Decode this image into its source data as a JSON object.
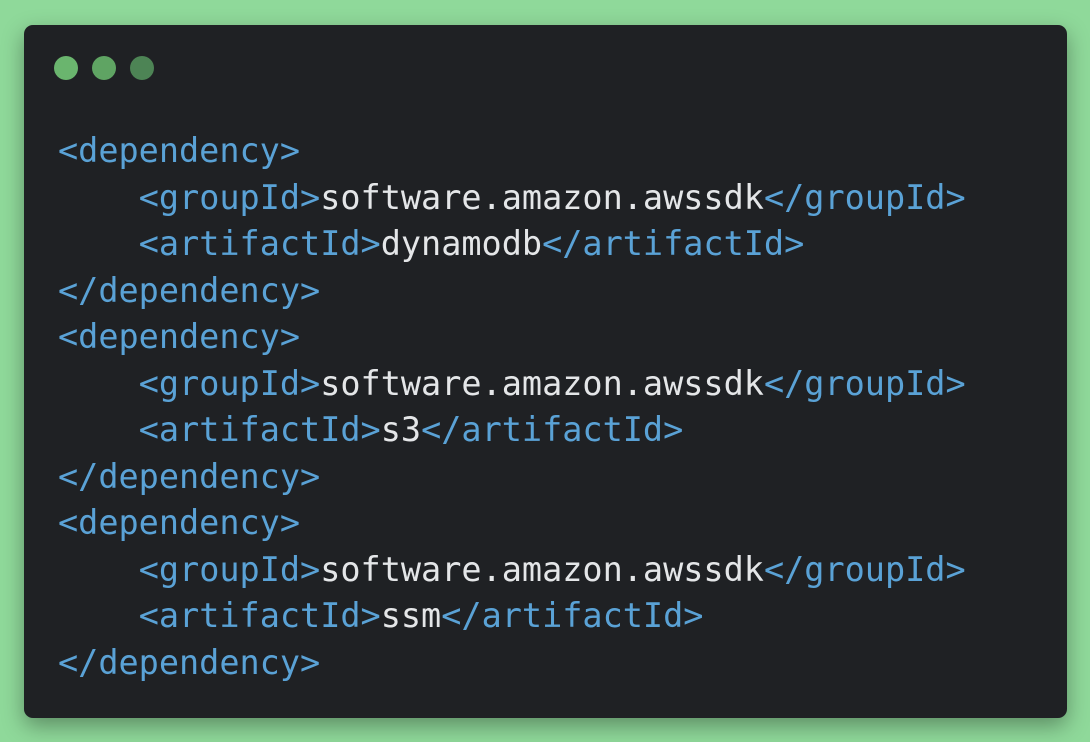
{
  "theme": {
    "background": "#8fd99a",
    "window_bg": "#1f2124",
    "tag_color": "#5aa2d6",
    "text_color": "#e4e6e8"
  },
  "window_controls": [
    {
      "name": "window-dot-1",
      "color": "#6ab56e"
    },
    {
      "name": "window-dot-2",
      "color": "#5fa463"
    },
    {
      "name": "window-dot-3",
      "color": "#4d8455"
    }
  ],
  "code_lines": [
    {
      "indent": "",
      "parts": [
        {
          "t": "tag",
          "v": "<dependency>"
        }
      ]
    },
    {
      "indent": "    ",
      "parts": [
        {
          "t": "tag",
          "v": "<groupId>"
        },
        {
          "t": "text",
          "v": "software.amazon.awssdk"
        },
        {
          "t": "tag",
          "v": "</groupId>"
        }
      ]
    },
    {
      "indent": "    ",
      "parts": [
        {
          "t": "tag",
          "v": "<artifactId>"
        },
        {
          "t": "text",
          "v": "dynamodb"
        },
        {
          "t": "tag",
          "v": "</artifactId>"
        }
      ]
    },
    {
      "indent": "",
      "parts": [
        {
          "t": "tag",
          "v": "</dependency>"
        }
      ]
    },
    {
      "indent": "",
      "parts": [
        {
          "t": "tag",
          "v": "<dependency>"
        }
      ]
    },
    {
      "indent": "    ",
      "parts": [
        {
          "t": "tag",
          "v": "<groupId>"
        },
        {
          "t": "text",
          "v": "software.amazon.awssdk"
        },
        {
          "t": "tag",
          "v": "</groupId>"
        }
      ]
    },
    {
      "indent": "    ",
      "parts": [
        {
          "t": "tag",
          "v": "<artifactId>"
        },
        {
          "t": "text",
          "v": "s3"
        },
        {
          "t": "tag",
          "v": "</artifactId>"
        }
      ]
    },
    {
      "indent": "",
      "parts": [
        {
          "t": "tag",
          "v": "</dependency>"
        }
      ]
    },
    {
      "indent": "",
      "parts": [
        {
          "t": "tag",
          "v": "<dependency>"
        }
      ]
    },
    {
      "indent": "    ",
      "parts": [
        {
          "t": "tag",
          "v": "<groupId>"
        },
        {
          "t": "text",
          "v": "software.amazon.awssdk"
        },
        {
          "t": "tag",
          "v": "</groupId>"
        }
      ]
    },
    {
      "indent": "    ",
      "parts": [
        {
          "t": "tag",
          "v": "<artifactId>"
        },
        {
          "t": "text",
          "v": "ssm"
        },
        {
          "t": "tag",
          "v": "</artifactId>"
        }
      ]
    },
    {
      "indent": "",
      "parts": [
        {
          "t": "tag",
          "v": "</dependency>"
        }
      ]
    }
  ]
}
